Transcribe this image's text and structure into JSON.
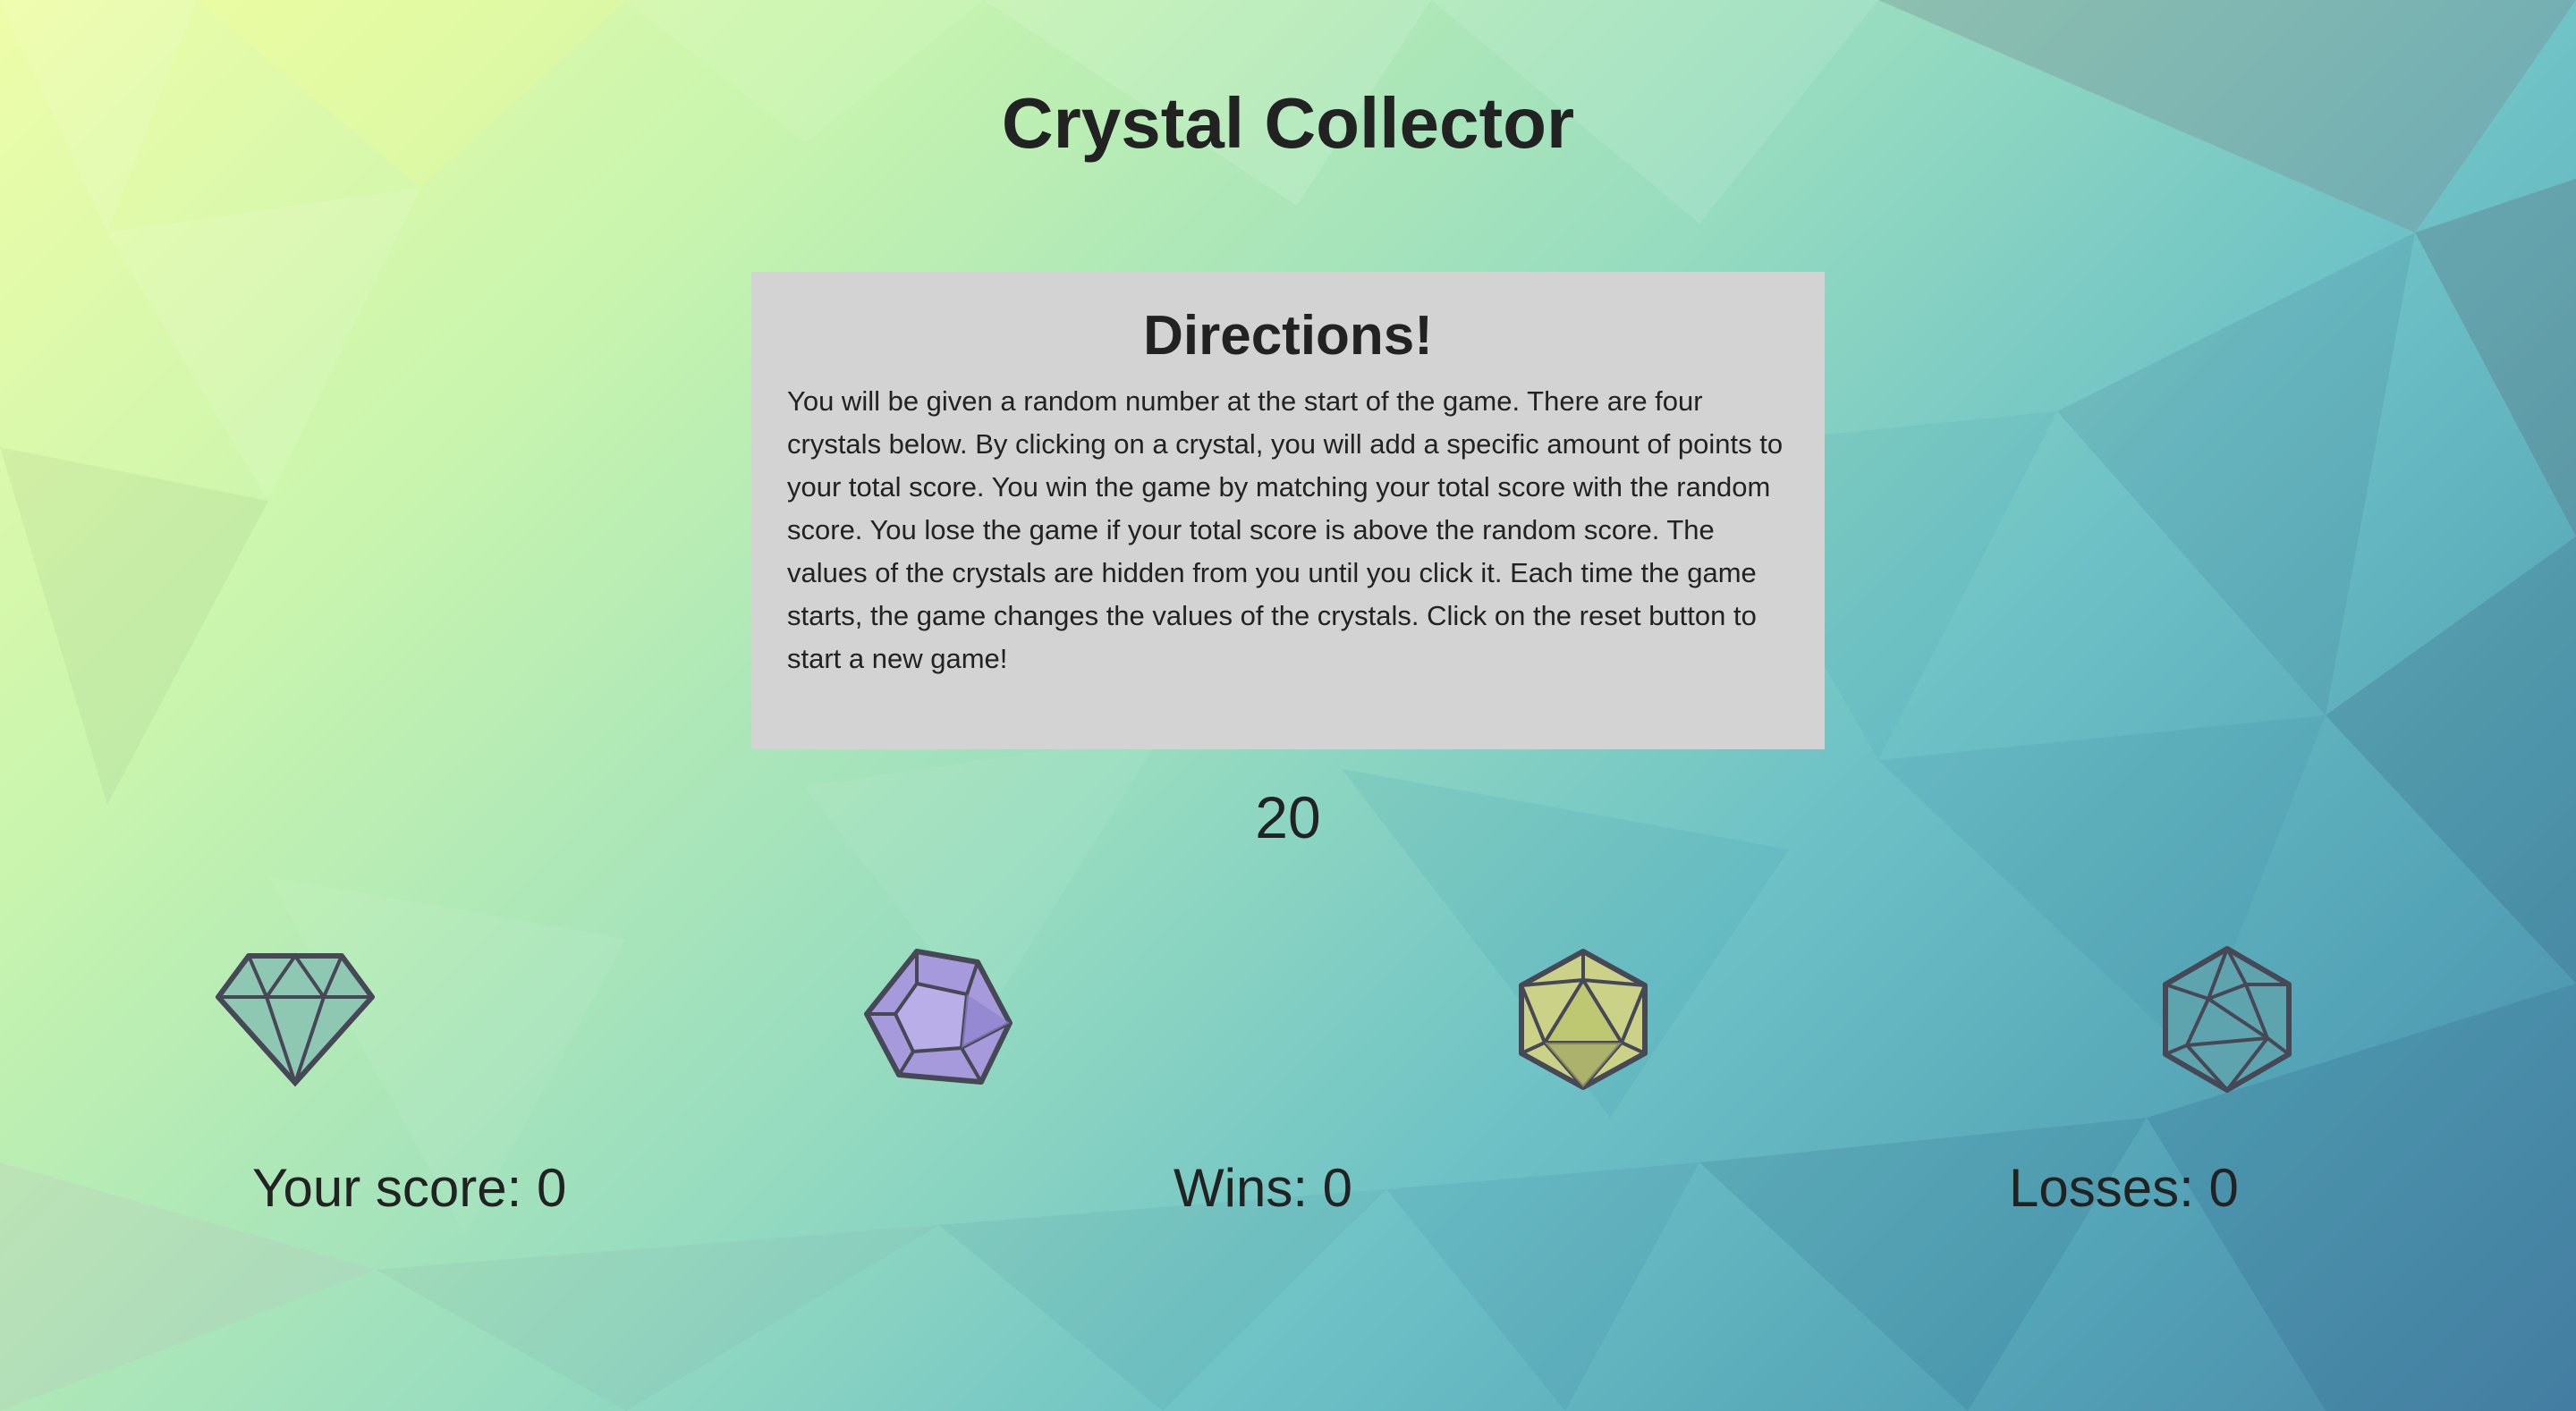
{
  "game": {
    "title": "Crystal Collector",
    "directions": {
      "heading": "Directions!",
      "text": "You will be given a random number at the start of the game. There are four crystals below. By clicking on a crystal, you will add a specific amount of points to your total score. You win the game by matching your total score with the random score. You lose the game if your total score is above the random score. The values of the crystals are hidden from you until you click it. Each time the game starts, the game changes the values of the crystals. Click on the reset button to start a new game!"
    },
    "target_number": "20",
    "crystals": [
      {
        "name": "diamond-crystal-icon",
        "fill": "#88c4b4"
      },
      {
        "name": "purple-d12-crystal-icon",
        "fill": "#a79be0"
      },
      {
        "name": "yellow-d20-crystal-icon",
        "fill": "#c9cf82"
      },
      {
        "name": "teal-d20-crystal-icon",
        "fill": "#5fa6b0"
      }
    ],
    "stats": {
      "score_label": "Your score: 0",
      "wins_label": "Wins: 0",
      "losses_label": "Losses: 0"
    }
  },
  "colors": {
    "panel_bg": "#d3d3d3",
    "text": "#222222",
    "crystal_stroke": "#474856"
  }
}
